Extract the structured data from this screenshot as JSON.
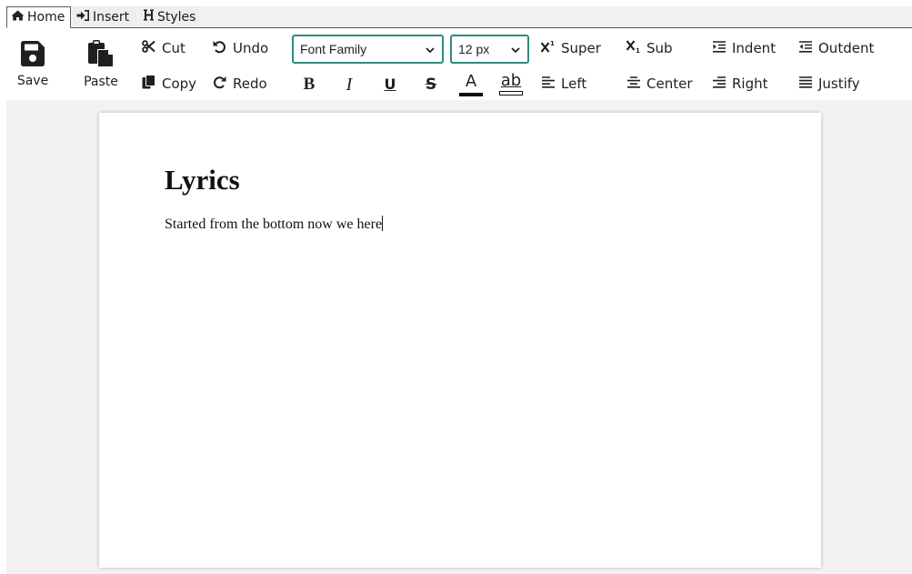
{
  "tabs": [
    {
      "label": "Home",
      "icon": "home-icon",
      "active": true
    },
    {
      "label": "Insert",
      "icon": "sign-in-icon",
      "active": false
    },
    {
      "label": "Styles",
      "icon": "heading-icon",
      "active": false
    }
  ],
  "ribbon": {
    "save_label": "Save",
    "paste_label": "Paste",
    "cut_label": "Cut",
    "copy_label": "Copy",
    "undo_label": "Undo",
    "redo_label": "Redo",
    "font_family": {
      "value": "Font Family"
    },
    "font_size": {
      "value": "12 px"
    },
    "format": {
      "bold": "B",
      "italic": "I",
      "underline": "U",
      "strikethrough": "S",
      "text_color": "A",
      "highlight": "ab"
    },
    "super_label": "Super",
    "sub_label": "Sub",
    "indent_label": "Indent",
    "outdent_label": "Outdent",
    "left_label": "Left",
    "center_label": "Center",
    "right_label": "Right",
    "justify_label": "Justify"
  },
  "document": {
    "title": "Lyrics",
    "body": "Started from the bottom now we here"
  },
  "colors": {
    "accent": "#2e8b7e",
    "text": "#1f1f1f",
    "workspace": "#f2f2f2"
  }
}
